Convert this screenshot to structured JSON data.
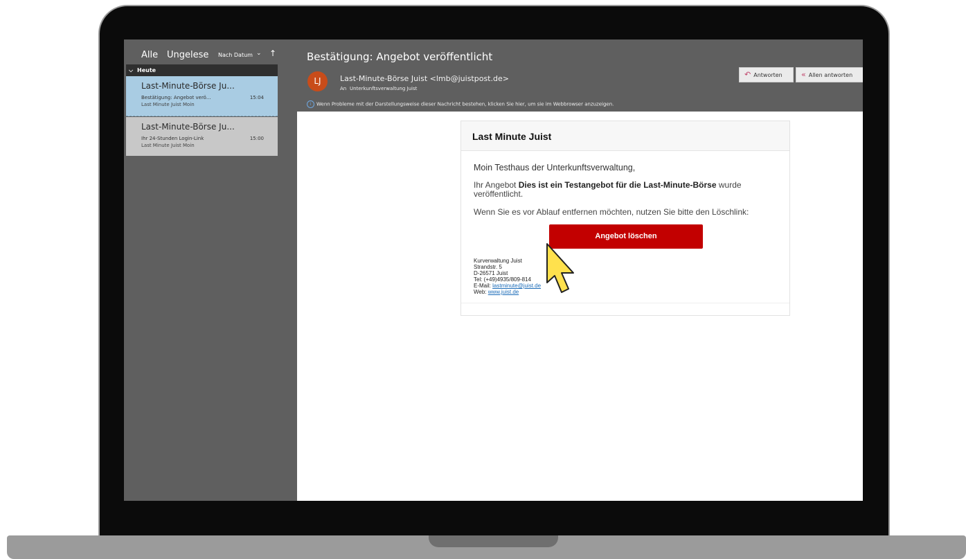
{
  "message_list": {
    "filter_all": "Alle",
    "filter_unread": "Ungelese",
    "sort_label": "Nach Datum",
    "sort_chevron": "⌄",
    "sort_arrow": "↑",
    "group_label": "Heute",
    "items": [
      {
        "sender": "Last-Minute-Börse Ju...",
        "subject": "Bestätigung: Angebot verö...",
        "time": "15:04",
        "preview": "Last Minute Juist  Moin"
      },
      {
        "sender": "Last-Minute-Börse Ju...",
        "subject": "Ihr 24-Stunden Login-Link",
        "time": "15:00",
        "preview": "Last Minute Juist  Moin"
      }
    ]
  },
  "reading_pane": {
    "title": "Bestätigung: Angebot veröffentlicht",
    "avatar_initials": "LJ",
    "from": "Last-Minute-Börse Juist <lmb@juistpost.de>",
    "to_label": "An",
    "to": "Unterkunftsverwaltung Juist",
    "info_message": "Wenn Probleme mit der Darstellungsweise dieser Nachricht bestehen, klicken Sie hier, um sie im Webbrowser anzuzeigen.",
    "reply_label": "Antworten",
    "reply_all_label": "Allen antworten"
  },
  "email": {
    "header_title": "Last Minute Juist",
    "greeting": "Moin Testhaus der Unterkunftsverwaltung,",
    "para1_pre": "Ihr Angebot ",
    "para1_bold": "Dies ist ein Testangebot für die Last-Minute-Börse",
    "para1_post": " wurde veröffentlicht.",
    "para2": "Wenn Sie es vor Ablauf entfernen möchten, nutzen Sie bitte den Löschlink:",
    "delete_button": "Angebot löschen",
    "footer": {
      "org": "Kurverwaltung Juist",
      "street": "Strandstr. 5",
      "city": "D-26571 Juist",
      "tel": "Tel: (+49)4935/809-814",
      "email_label": "E-Mail: ",
      "email": "lastminute@juist.de",
      "web_label": "Web: ",
      "web": "www.juist.de"
    }
  },
  "colors": {
    "accent_delete": "#c20000",
    "selected_item": "#a9cce3",
    "avatar": "#c84c1a"
  }
}
